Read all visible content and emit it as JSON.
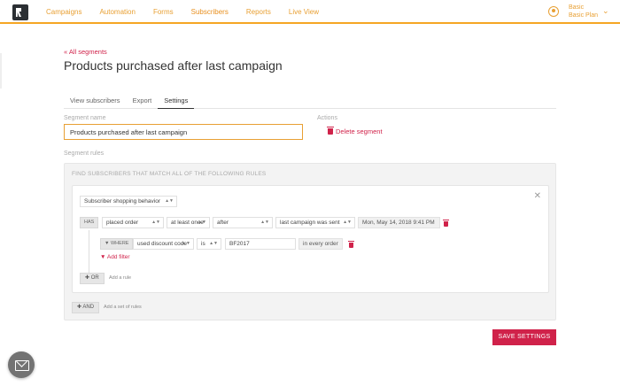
{
  "nav": {
    "items": [
      "Campaigns",
      "Automation",
      "Forms",
      "Subscribers",
      "Reports",
      "Live View"
    ],
    "active_index": 3,
    "accent": "#f5a623"
  },
  "account": {
    "name": "Basic",
    "plan": "Basic Plan"
  },
  "header": {
    "back_link": "« All segments",
    "title": "Products purchased after last campaign"
  },
  "tabs": [
    "View subscribers",
    "Export",
    "Settings"
  ],
  "form": {
    "segment_name_label": "Segment name",
    "segment_name_value": "Products purchased after last campaign",
    "actions_label": "Actions",
    "delete_label": "Delete segment",
    "rules_label": "Segment rules"
  },
  "rules": {
    "heading": "FIND SUBSCRIBERS THAT MATCH ALL OF THE FOLLOWING RULES",
    "category": "Subscriber shopping behavior",
    "condition": {
      "has": "HAS",
      "action": "placed order",
      "quantifier": "at least once",
      "timing": "after",
      "reference": "last campaign was sent",
      "date": "Mon, May 14, 2018 9:41 PM"
    },
    "filter": {
      "where": "WHERE",
      "field": "used discount code",
      "operator": "is",
      "value": "BF2017",
      "scope": "in every order"
    },
    "add_filter": "Add filter",
    "or_label": "OR",
    "add_rule_hint": "Add a rule",
    "and_label": "AND",
    "add_set_hint": "Add a set of rules"
  },
  "save_label": "SAVE SETTINGS",
  "colors": {
    "brand_red": "#d0224a",
    "accent_orange": "#e8a034"
  }
}
